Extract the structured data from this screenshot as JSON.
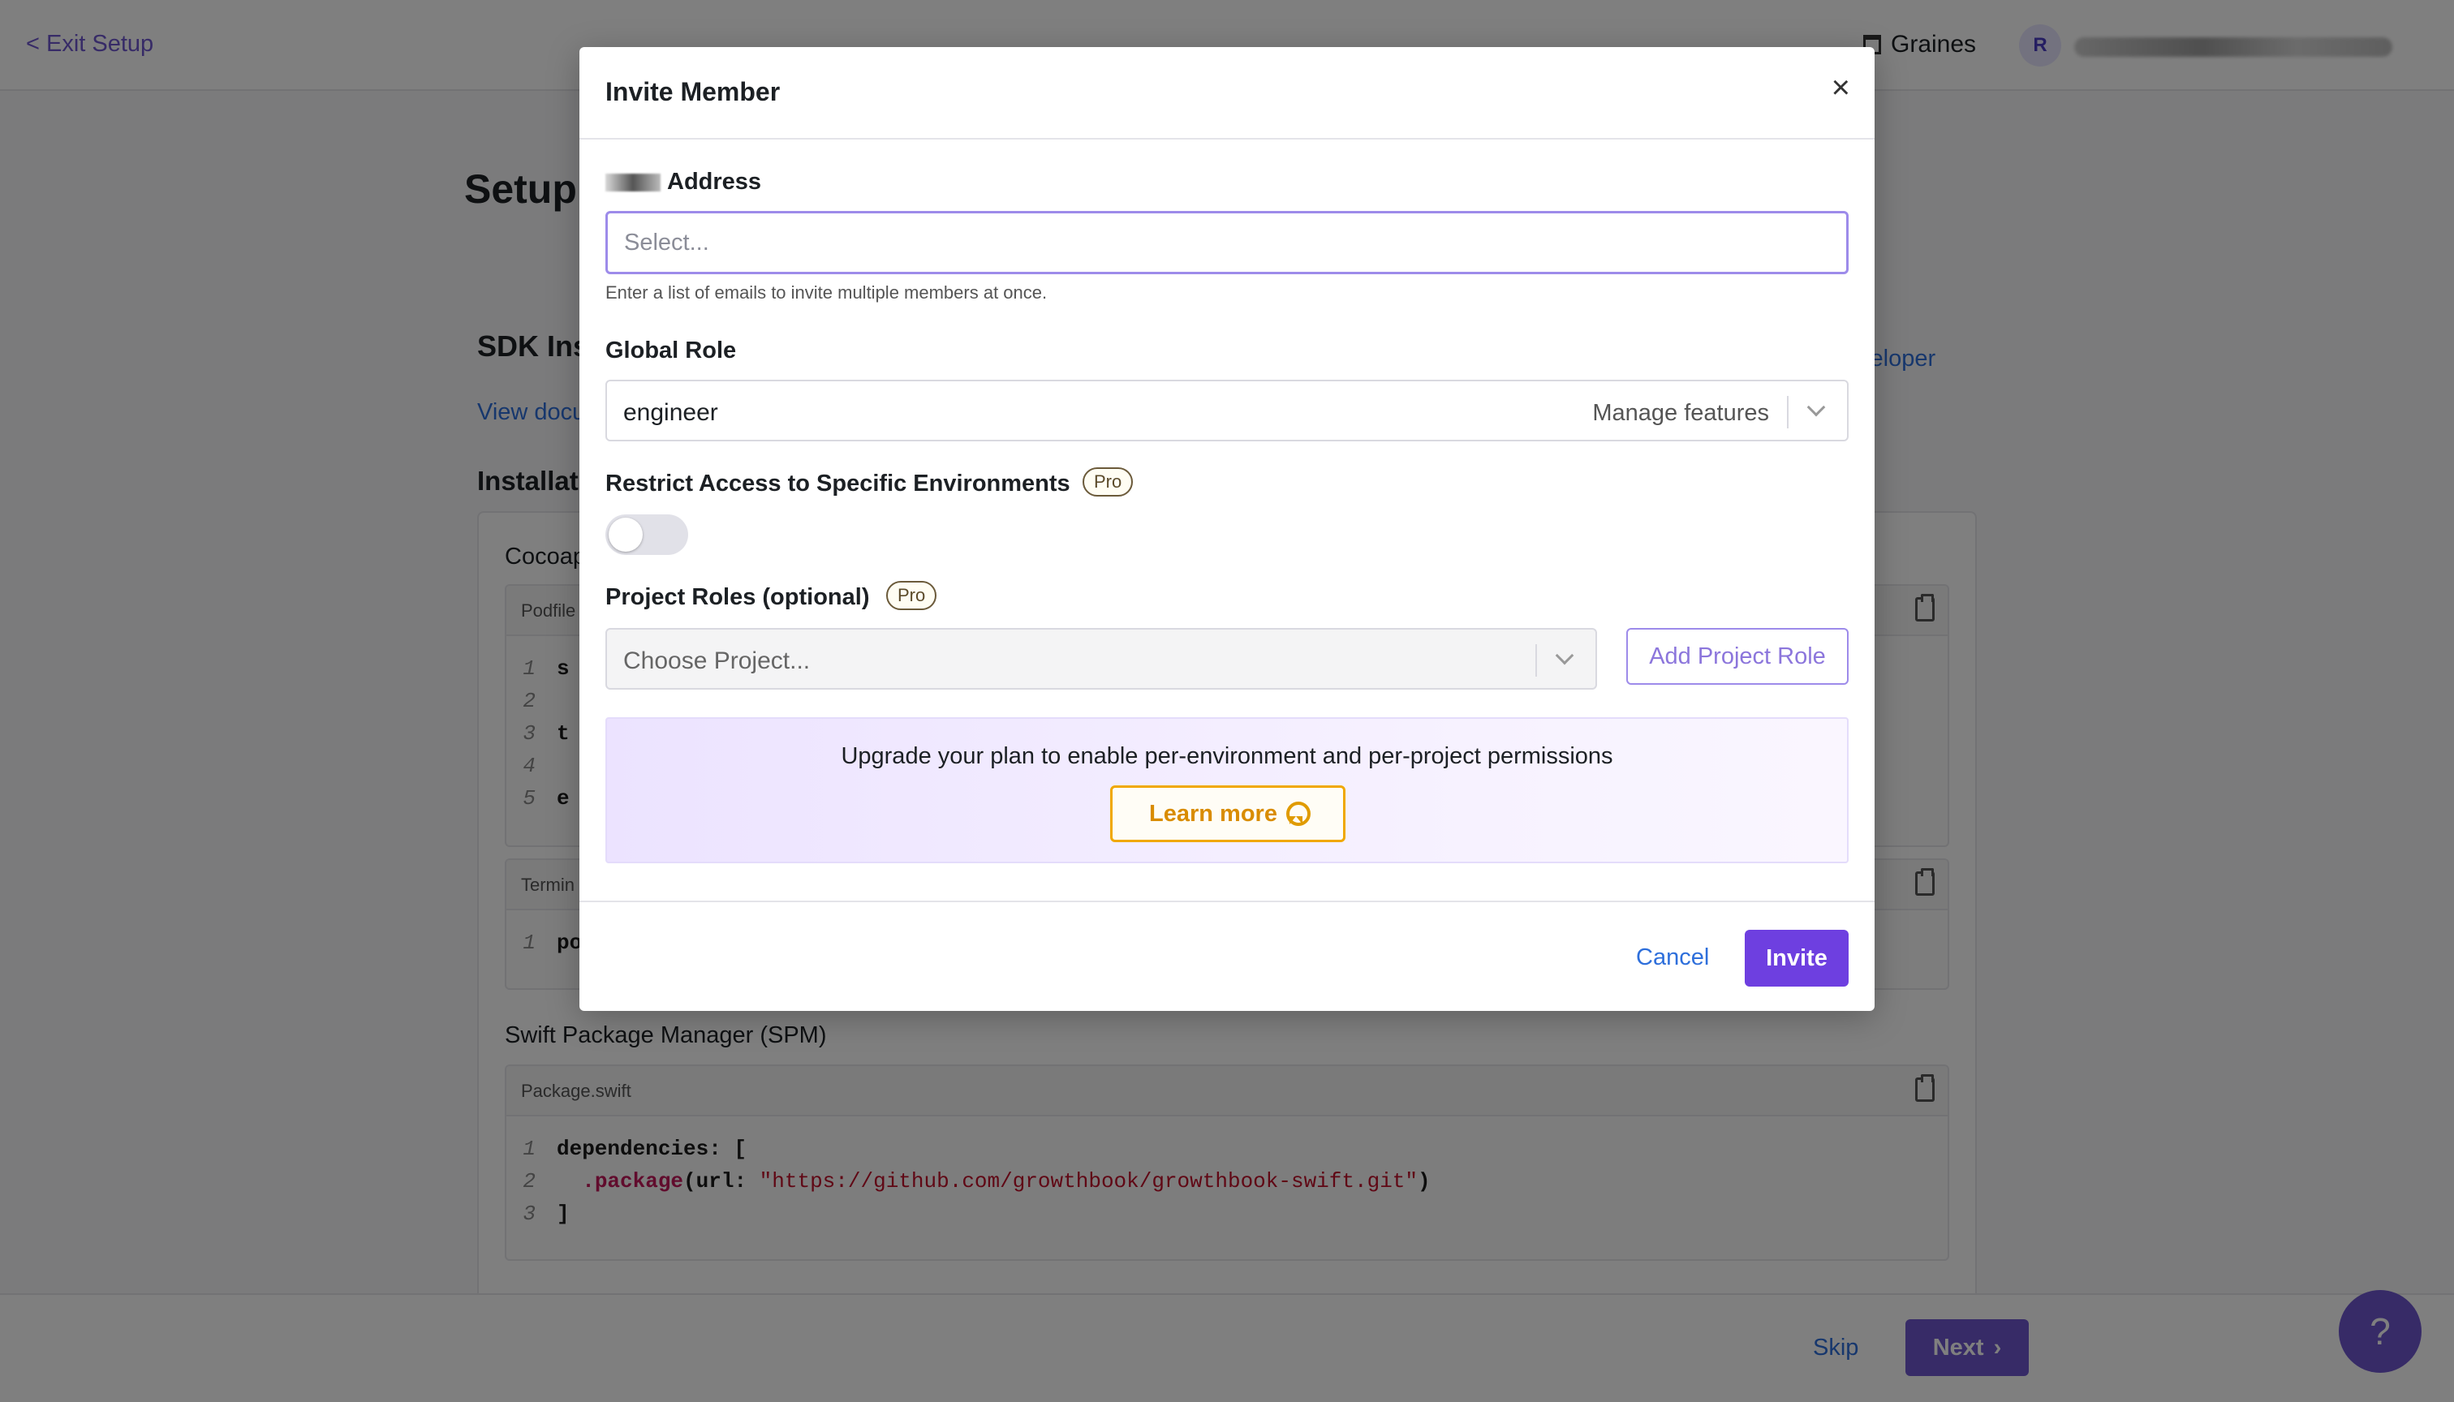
{
  "header": {
    "exit_label": "< Exit Setup",
    "org_name": "Graines",
    "avatar_initial": "R"
  },
  "page": {
    "title": "Setup",
    "sdk_section_title": "SDK Ins",
    "view_docs": "View docu",
    "developer_link": "veloper",
    "installation_title": "Installati"
  },
  "code_blocks": [
    {
      "package_label": "Cocoap",
      "filename": "Podfile",
      "lines": [
        {
          "num": "1",
          "text": "s"
        },
        {
          "num": "2",
          "text": ""
        },
        {
          "num": "3",
          "text": "t"
        },
        {
          "num": "4",
          "text": ""
        },
        {
          "num": "5",
          "text": "e"
        }
      ]
    },
    {
      "filename": "Termin",
      "lines": [
        {
          "num": "1",
          "text": "po"
        }
      ]
    },
    {
      "package_label": "Swift Package Manager (SPM)",
      "filename": "Package.swift",
      "lines": [
        {
          "num": "1",
          "text": "dependencies: ["
        },
        {
          "num": "2",
          "fn": ".package",
          "pre": "  ",
          "mid": "(url: ",
          "str": "\"https://github.com/growthbook/growthbook-swift.git\"",
          "post": ")"
        },
        {
          "num": "3",
          "text": "]"
        }
      ]
    }
  ],
  "footer": {
    "skip_label": "Skip",
    "next_label": "Next",
    "help_label": "?"
  },
  "modal": {
    "title": "Invite Member",
    "close_glyph": "×",
    "email": {
      "label": "Address",
      "placeholder": "Select...",
      "value": "",
      "hint": "Enter a list of emails to invite multiple members at once."
    },
    "global_role": {
      "label": "Global Role",
      "value": "engineer",
      "manage_features": "Manage features"
    },
    "restrict": {
      "label": "Restrict Access to Specific Environments",
      "badge": "Pro",
      "enabled": false
    },
    "project_roles": {
      "label": "Project Roles (optional)",
      "badge": "Pro",
      "placeholder": "Choose Project...",
      "add_button": "Add Project Role"
    },
    "upgrade": {
      "text": "Upgrade your plan to enable per-environment and per-project permissions",
      "learn_more": "Learn more"
    },
    "cancel_label": "Cancel",
    "invite_label": "Invite"
  },
  "colors": {
    "accent": "#6e56cf",
    "invite_button": "#6e3fe0",
    "link": "#2e6fdb",
    "learn_more": "#f0a800"
  },
  "icons": {
    "close": "close-icon",
    "chevron": "chevron-down-icon",
    "clipboard": "clipboard-icon",
    "ribbon": "award-ribbon-icon",
    "help": "question-icon"
  }
}
